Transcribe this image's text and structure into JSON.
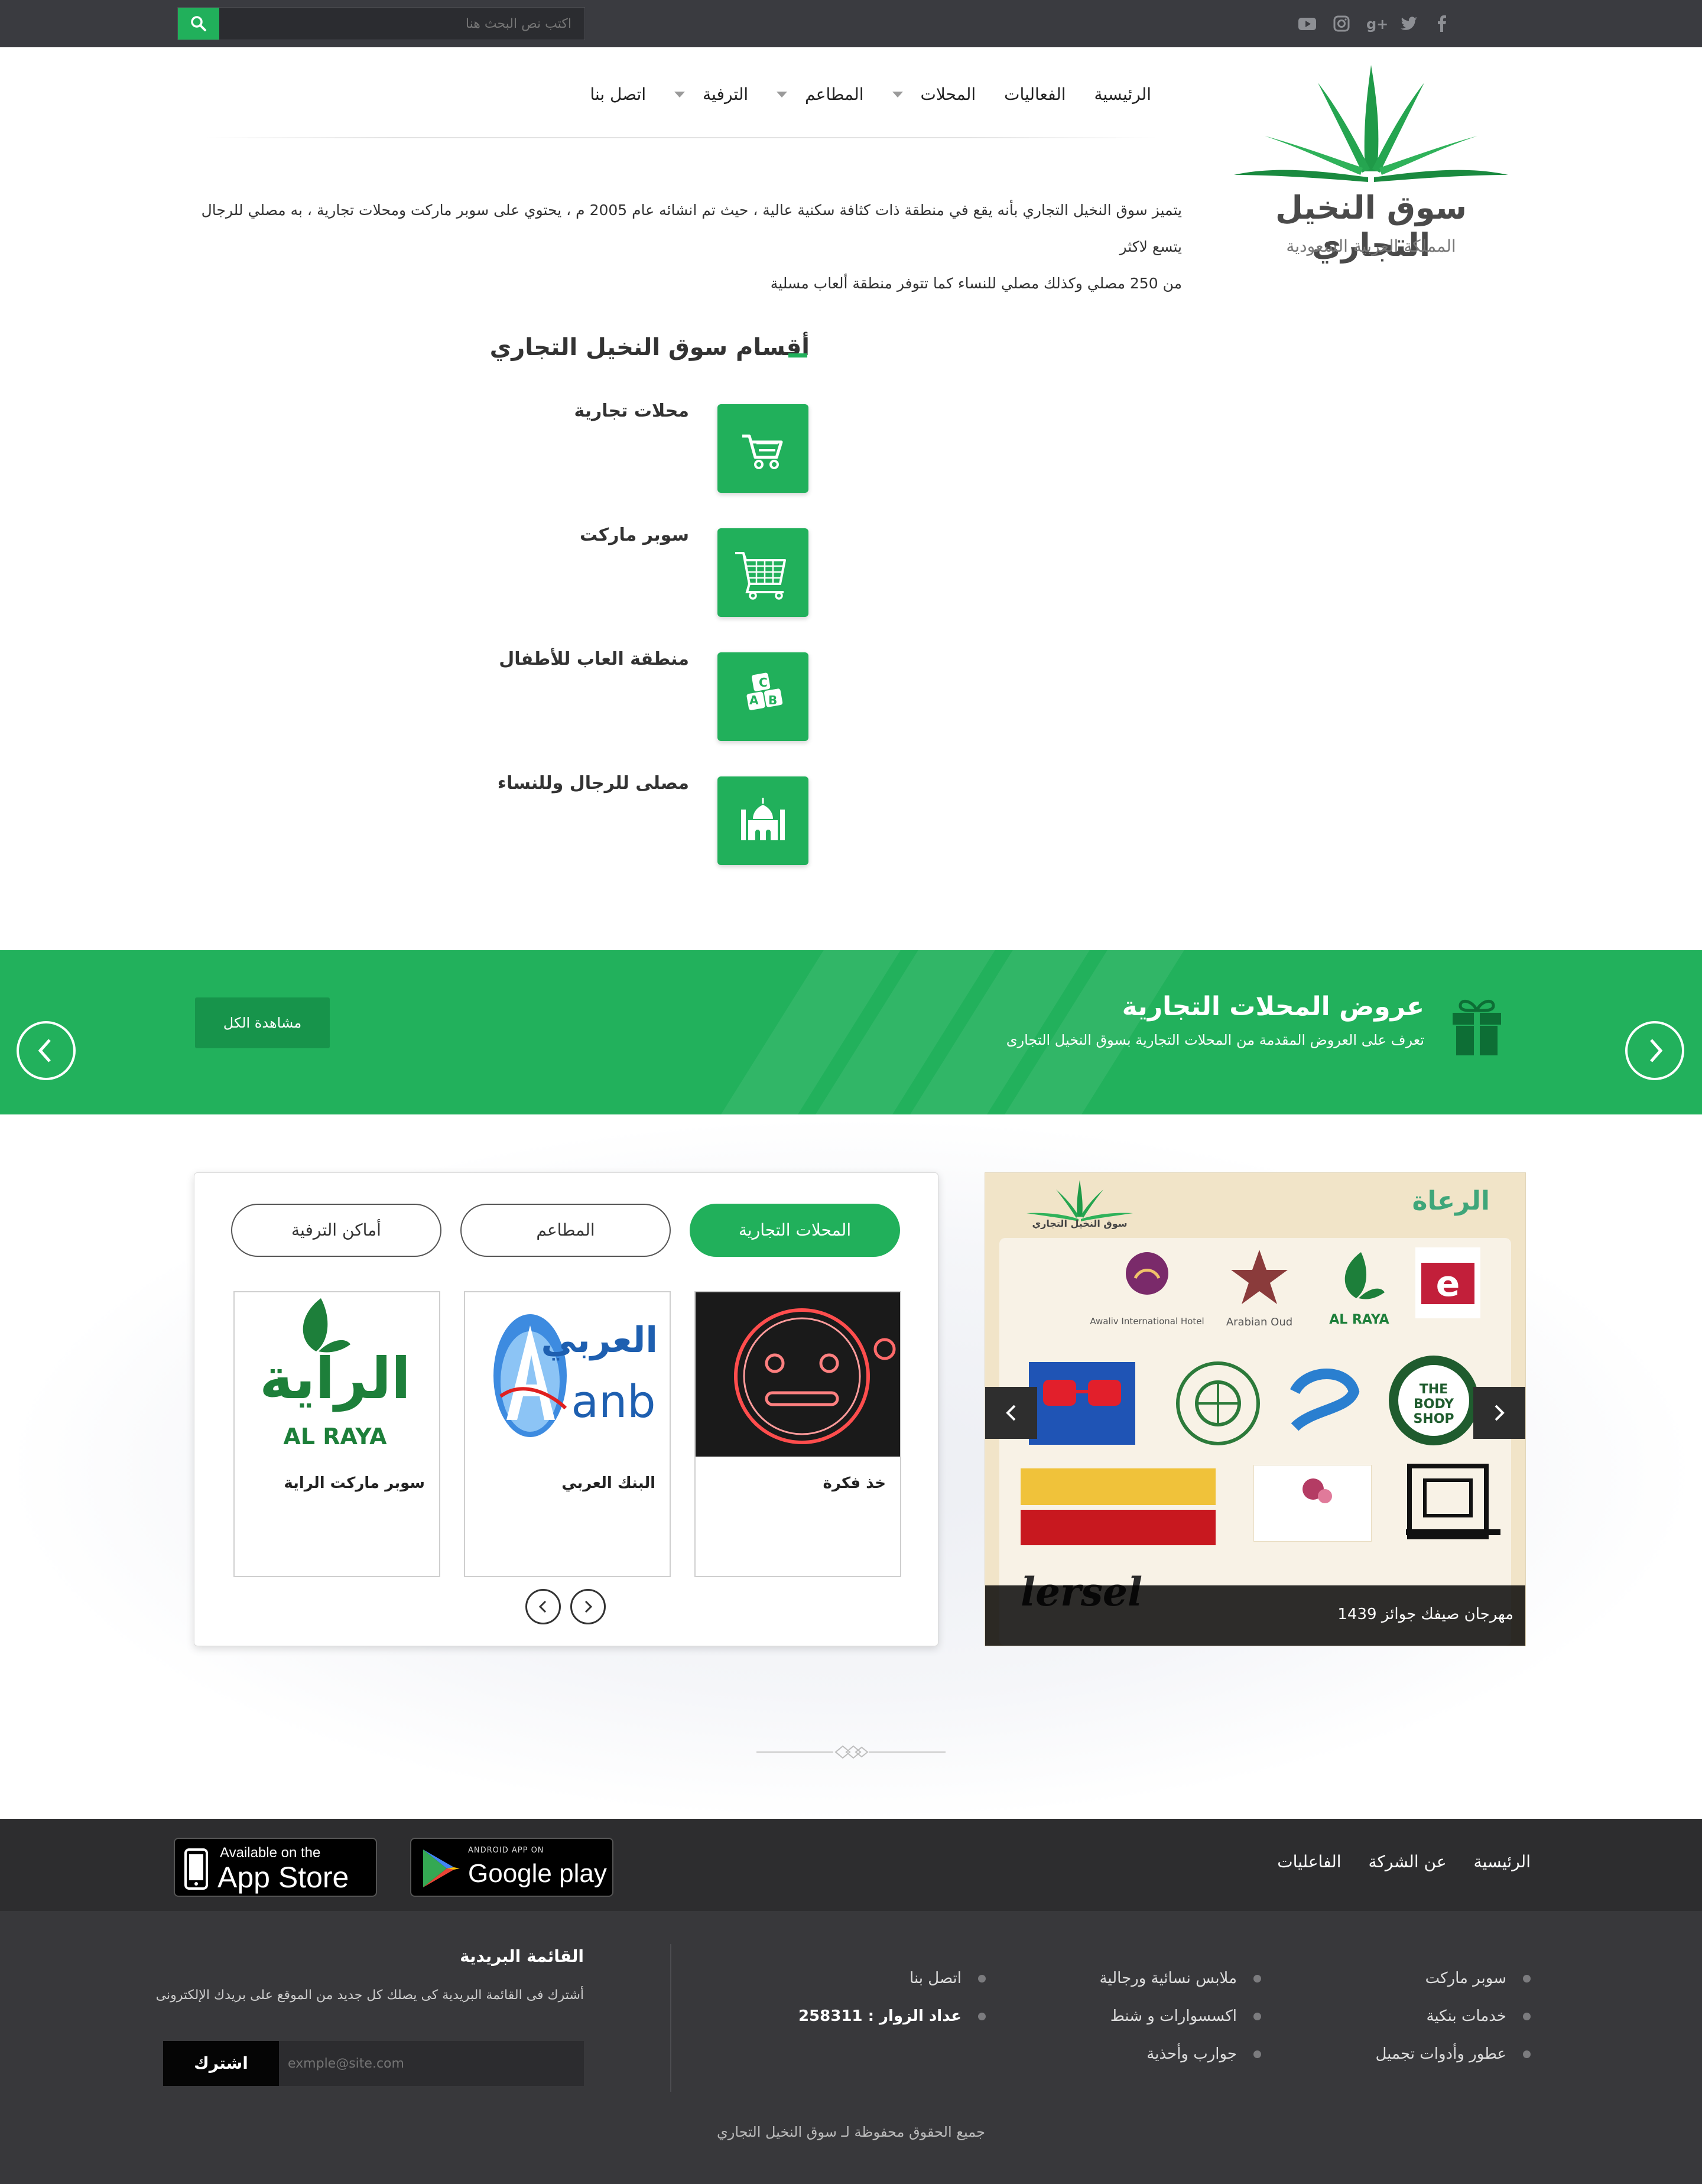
{
  "topbar": {
    "search_placeholder": "اكتب نص البحث هنا",
    "social_icons": [
      "facebook-icon",
      "twitter-icon",
      "google-plus-icon",
      "instagram-icon",
      "youtube-icon"
    ]
  },
  "header": {
    "logo_title": "سوق النخيل التجاري",
    "logo_subtitle": "المملكة العربية السعودية",
    "nav": [
      {
        "label": "الرئيسية"
      },
      {
        "label": "الفعاليات"
      },
      {
        "label": "المحلات"
      },
      {
        "label": "المطاعم"
      },
      {
        "label": "الترفية"
      },
      {
        "label": "اتصل بنا"
      }
    ],
    "intro_line1": "يتميز سوق النخيل التجاري بأنه يقع في منطقة ذات كثافة سكنية عالية ، حيث تم انشائه عام 2005 م ، يحتوي على سوبر ماركت ومحلات تجارية ، به مصلي للرجال يتسع لاكثر",
    "intro_line2": "من 250 مصلي وكذلك مصلي للنساء كما تتوفر منطقة ألعاب مسلية"
  },
  "sections": {
    "title": "أقسام سوق النخيل التجاري",
    "items": [
      {
        "label": "محلات تجارية",
        "icon": "shopping-cart-icon"
      },
      {
        "label": "سوبر ماركت",
        "icon": "supermarket-cart-icon"
      },
      {
        "label": "منطقة العاب للأطفال",
        "icon": "abc-blocks-icon"
      },
      {
        "label": "مصلى للرجال وللنساء",
        "icon": "mosque-icon"
      }
    ]
  },
  "offers_banner": {
    "title": "عروض المحلات التجارية",
    "subtitle": "تعرف على العروض المقدمة من المحلات التجارية بسوق النخيل التجارى",
    "view_all": "مشاهدة الكل"
  },
  "tabs": {
    "items": [
      {
        "label": "المحلات التجارية",
        "active": true
      },
      {
        "label": "المطاعم",
        "active": false
      },
      {
        "label": "أماكن الترفية",
        "active": false
      }
    ],
    "cards": [
      {
        "name": "خذ فكرة"
      },
      {
        "name": "البنك العربي",
        "logo_text": "العربي",
        "logo_sub": "anb"
      },
      {
        "name": "سوبر ماركت الراية",
        "logo_text": "الراية",
        "logo_sub": "AL RAYA"
      }
    ]
  },
  "poster": {
    "heading": "الرعاة",
    "brand": "سوق النخيل التجاري",
    "caption": "مهرجان صيفك جوائز 1439",
    "sponsors": [
      "AL RAYA",
      "Arabian Oud",
      "Awaliv International Hotel",
      "THE BODY SHOP",
      "lersel"
    ]
  },
  "footer": {
    "links": [
      {
        "label": "الرئيسية"
      },
      {
        "label": "عن الشركة"
      },
      {
        "label": "الفاعليات"
      }
    ],
    "app_store_small": "Available on the",
    "app_store_big": "App Store",
    "google_small": "ANDROID APP ON",
    "google_big": "Google play",
    "col1": [
      "سوبر ماركت",
      "خدمات بنكية",
      "عطور وأدوات تجميل"
    ],
    "col2": [
      "ملابس نسائية ورجالية",
      "اكسسوارات و شنط",
      "جوارب وأحذية"
    ],
    "col3_contact": "اتصل بنا",
    "visitors_label": "عداد الزوار : 258311",
    "newsletter_title": "القائمة البريدية",
    "newsletter_desc": "أشترك فى القائمة البريدية كى يصلك كل جديد من الموقع على بريدك الإلكترونى",
    "email_placeholder": "exmple@site.com",
    "subscribe": "اشترك",
    "copyright": "جميع الحقوق محفوظة لـ سوق النخيل التجاري"
  },
  "colors": {
    "brand_green": "#21b05b",
    "topbar": "#3a3b40",
    "footer_dark": "#2d2d2f",
    "footer_main": "#38383b"
  }
}
